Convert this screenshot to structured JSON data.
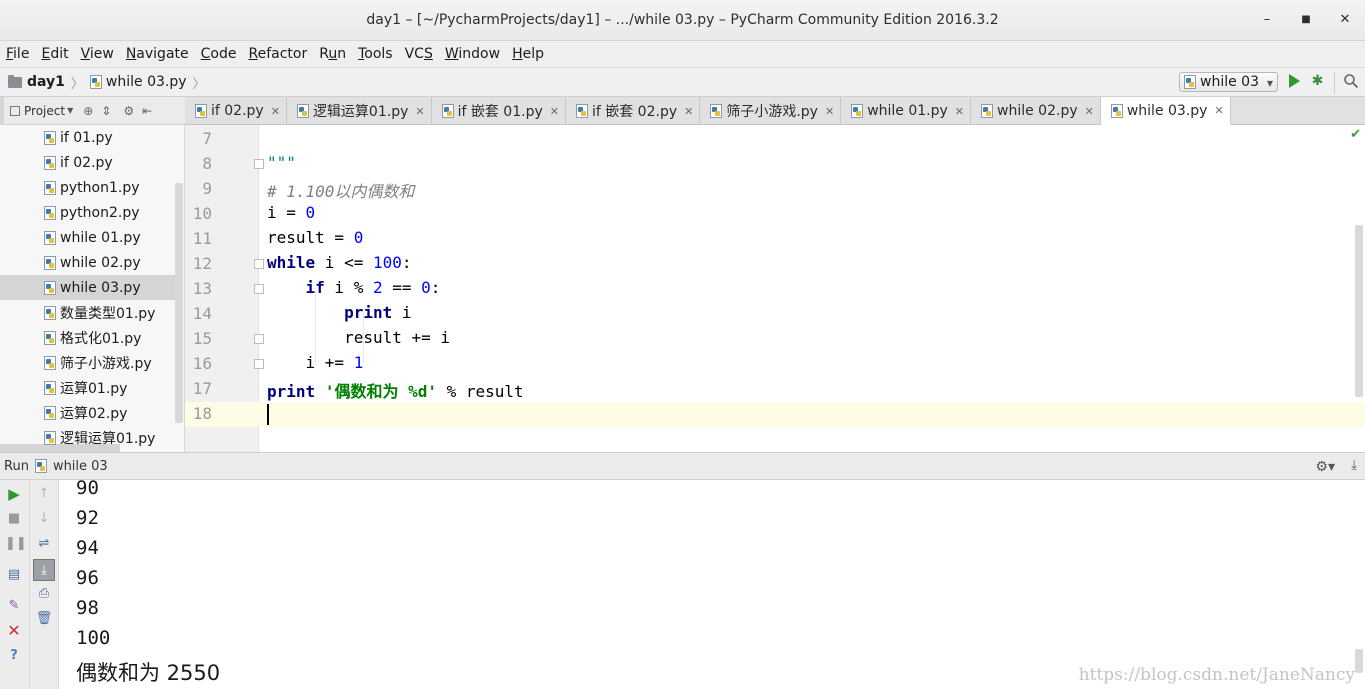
{
  "window": {
    "title": "day1 – [~/PycharmProjects/day1] – .../while 03.py – PyCharm Community Edition 2016.3.2"
  },
  "menu": [
    {
      "pre": "",
      "u": "F",
      "post": "ile"
    },
    {
      "pre": "",
      "u": "E",
      "post": "dit"
    },
    {
      "pre": "",
      "u": "V",
      "post": "iew"
    },
    {
      "pre": "",
      "u": "N",
      "post": "avigate"
    },
    {
      "pre": "",
      "u": "C",
      "post": "ode"
    },
    {
      "pre": "",
      "u": "R",
      "post": "efactor"
    },
    {
      "pre": "R",
      "u": "u",
      "post": "n"
    },
    {
      "pre": "",
      "u": "T",
      "post": "ools"
    },
    {
      "pre": "VC",
      "u": "S",
      "post": ""
    },
    {
      "pre": "",
      "u": "W",
      "post": "indow"
    },
    {
      "pre": "",
      "u": "H",
      "post": "elp"
    }
  ],
  "breadcrumb": {
    "project": "day1",
    "file": "while 03.py"
  },
  "run_config": {
    "label": "while 03"
  },
  "project_panel": {
    "label": "Project",
    "files": [
      "if 01.py",
      "if 02.py",
      "python1.py",
      "python2.py",
      "while 01.py",
      "while 02.py",
      "while 03.py",
      "数量类型01.py",
      "格式化01.py",
      "筛子小游戏.py",
      "运算01.py",
      "运算02.py",
      "逻辑运算01.py"
    ],
    "selected_index": 6
  },
  "tabs": [
    "if 02.py",
    "逻辑运算01.py",
    "if 嵌套 01.py",
    "if 嵌套 02.py",
    "筛子小游戏.py",
    "while 01.py",
    "while 02.py",
    "while 03.py"
  ],
  "active_tab_index": 7,
  "editor": {
    "line_numbers": [
      "7",
      "8",
      "9",
      "10",
      "11",
      "12",
      "13",
      "14",
      "15",
      "16",
      "17",
      "18"
    ],
    "code": {
      "l8": "\"\"\"",
      "l9": "# 1.100以内偶数和",
      "l10_a": "i = ",
      "l10_b": "0",
      "l11_a": "result = ",
      "l11_b": "0",
      "l12_kw": "while",
      "l12_a": " i <= ",
      "l12_b": "100",
      "l12_c": ":",
      "l13_kw": "if",
      "l13_a": " i % ",
      "l13_b": "2",
      "l13_c": " == ",
      "l13_d": "0",
      "l13_e": ":",
      "l14_kw": "print",
      "l14_a": " i",
      "l15": "result += i",
      "l16_a": "i += ",
      "l16_b": "1",
      "l17_kw": "print",
      "l17_str": "'偶数和为 %d'",
      "l17_a": " % result"
    }
  },
  "run_panel": {
    "label": "Run",
    "config": "while 03",
    "output": [
      "90",
      "92",
      "94",
      "96",
      "98",
      "100",
      "偶数和为 2550"
    ],
    "watermark": "https://blog.csdn.net/JaneNancy"
  },
  "colors": {
    "keyword": "#000080",
    "number": "#0000ff",
    "string": "#008000",
    "comment": "#808080",
    "run_green": "#2e9a2e"
  }
}
